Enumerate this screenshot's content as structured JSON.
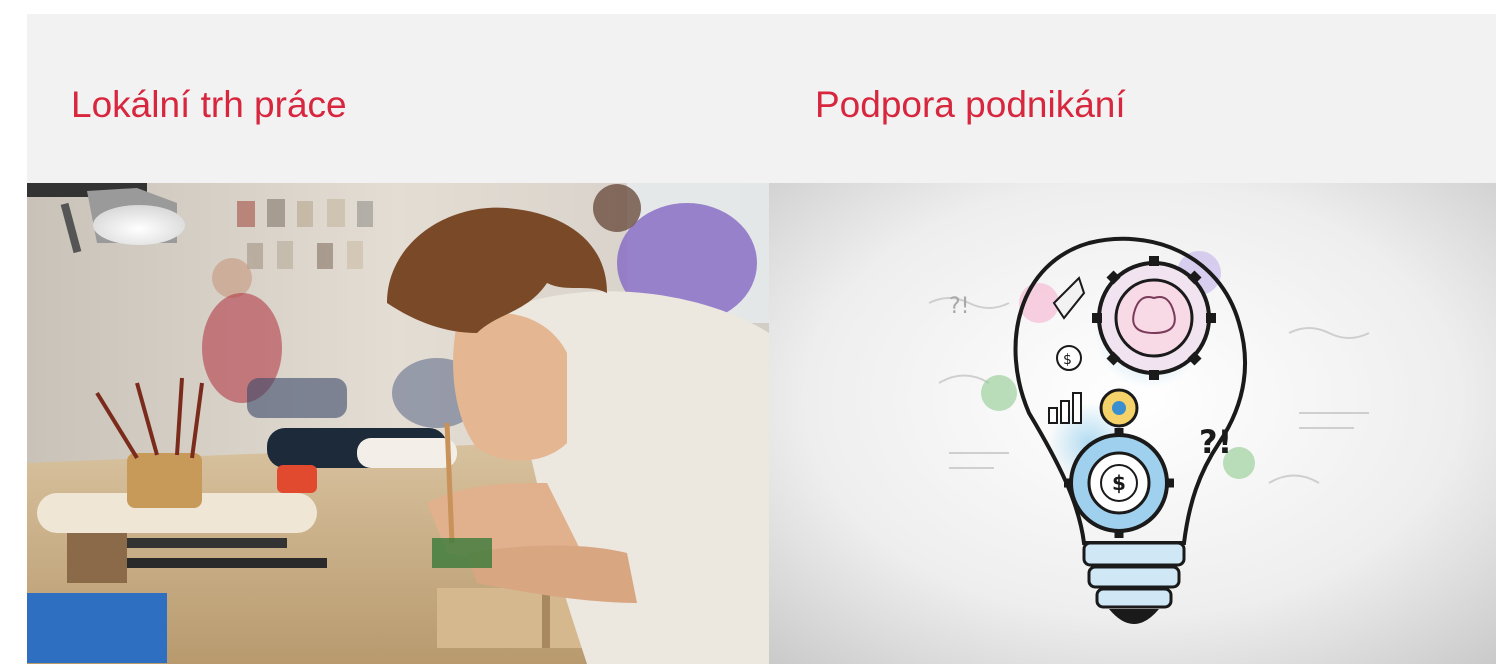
{
  "cards": [
    {
      "title": "Lokální trh práce",
      "image_alt": "Mladý muž pracuje u stolu v ateliéru"
    },
    {
      "title": "Podpora podnikání",
      "image_alt": "Náčrt žárovky s ozubenými koly a ikonami podnikání"
    }
  ],
  "colors": {
    "title": "#d7263d",
    "panel_background": "#f2f2f2"
  }
}
